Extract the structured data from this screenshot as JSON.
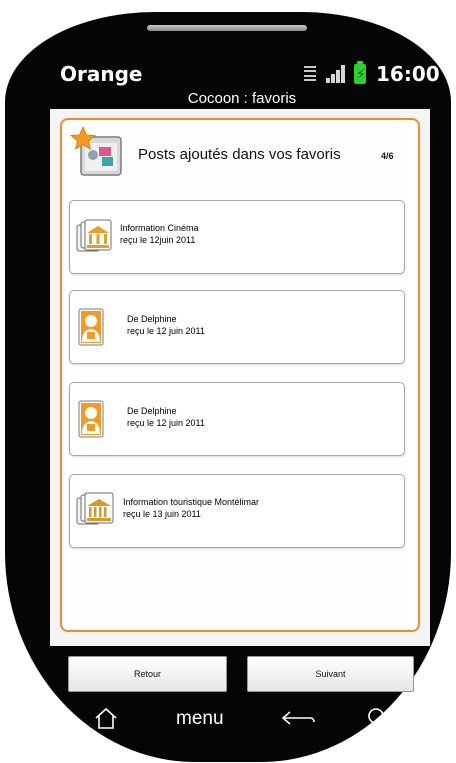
{
  "status_bar": {
    "carrier": "Orange",
    "network_icon": "data-transfer-icon",
    "signal_icon": "signal-icon",
    "battery_icon": "battery-charging-icon",
    "time": "16:00"
  },
  "screen": {
    "title": "Cocoon :  favoris"
  },
  "header": {
    "title": "Posts ajoutés dans vos favoris",
    "page_indicator": "4/6",
    "icon": "favorites-star-icon"
  },
  "posts": [
    {
      "icon": "cinema-building-icon",
      "line1": "Information Cinéma",
      "line2": "reçu le 12juin 2011"
    },
    {
      "icon": "person-contact-icon",
      "line1": "De Delphine",
      "line2": "reçu le 12 juin 2011"
    },
    {
      "icon": "person-contact-icon",
      "line1": "De Delphine",
      "line2": "reçu le 12 juin 2011"
    },
    {
      "icon": "museum-building-icon",
      "line1": "Information touristique Montélimar",
      "line2": "reçu le 13 juin 2011"
    }
  ],
  "buttons": {
    "back_label": "Retour",
    "next_label": "Suivant"
  },
  "nav": {
    "home_icon": "home-icon",
    "menu_label": "menu",
    "back_icon": "back-arrow-icon",
    "search_icon": "search-icon"
  },
  "colors": {
    "accent": "#f08a2a",
    "phone_body": "#050505",
    "battery": "#2fd02f"
  }
}
